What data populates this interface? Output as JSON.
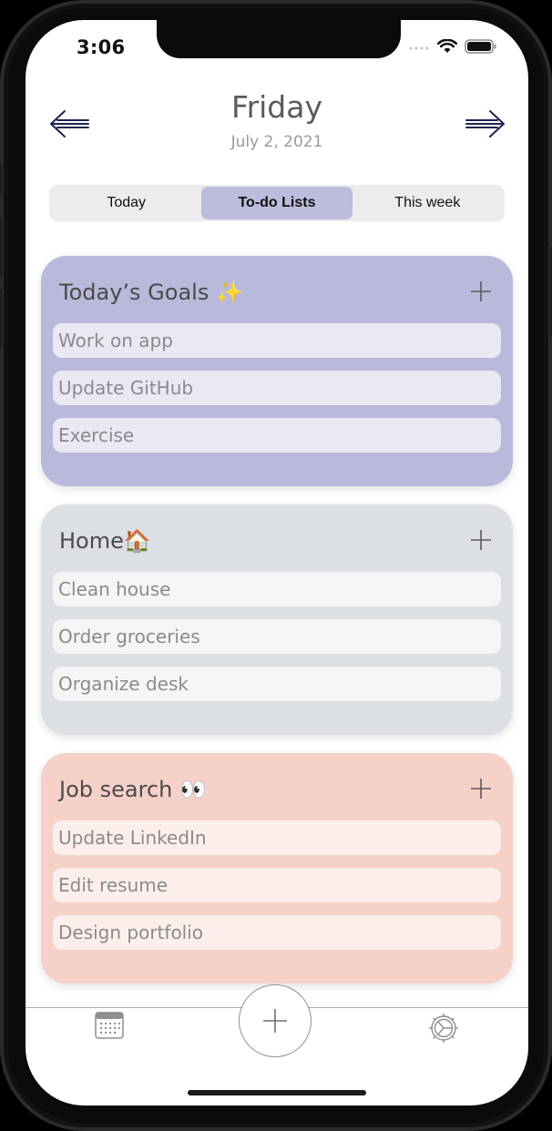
{
  "status_bar": {
    "time": "3:06"
  },
  "header": {
    "day": "Friday",
    "date": "July 2, 2021",
    "prev_icon": "arrow-left-icon",
    "next_icon": "arrow-right-icon"
  },
  "segments": [
    {
      "label": "Today",
      "selected": false
    },
    {
      "label": "To-do Lists",
      "selected": true
    },
    {
      "label": "This week",
      "selected": false
    }
  ],
  "lists": [
    {
      "title": "Today’s Goals ✨",
      "color": "#b9b9db",
      "task_bg": "#e9e8f3",
      "tasks": [
        "Work on app",
        "Update GitHub",
        "Exercise"
      ]
    },
    {
      "title": "Home🏠",
      "color": "#dcdfe4",
      "task_bg": "#f4f5f7",
      "tasks": [
        "Clean house",
        "Order groceries",
        "Organize desk"
      ]
    },
    {
      "title": "Job search 👀",
      "color": "#f6d1c7",
      "task_bg": "#fcefeb",
      "tasks": [
        "Update LinkedIn",
        "Edit resume",
        "Design portfolio"
      ]
    }
  ],
  "tab_bar": {
    "left_icon": "calendar-icon",
    "center_icon": "plus-icon",
    "right_icon": "settings-icon"
  }
}
